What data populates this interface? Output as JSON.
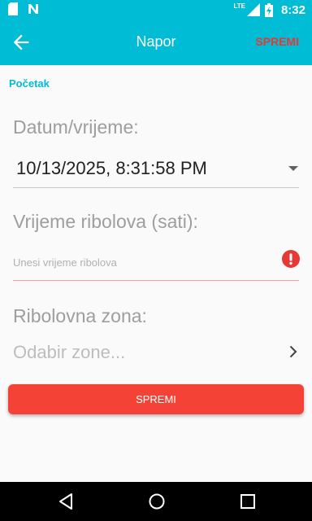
{
  "status_bar": {
    "time": "8:32",
    "network": "LTE",
    "icons": [
      "sd-card-icon",
      "n-notification-icon",
      "signal-icon",
      "battery-icon"
    ]
  },
  "toolbar": {
    "back_icon": "arrow-back-icon",
    "title": "Napor",
    "save_label": "SPREMI"
  },
  "breadcrumb": "Početak",
  "form": {
    "datetime_label": "Datum/vrijeme:",
    "datetime_value": "10/13/2025, 8:31:58 PM",
    "fishing_time_label": "Vrijeme ribolova (sati):",
    "fishing_time_placeholder": "Unesi vrijeme ribolova",
    "fishing_time_value": "",
    "zone_label": "Ribolovna zona:",
    "zone_placeholder": "Odabir zone..."
  },
  "save_button_label": "SPREMI",
  "nav_bar": {
    "buttons": [
      "back-triangle-icon",
      "home-circle-icon",
      "recents-square-icon"
    ]
  },
  "colors": {
    "primary": "#00bcd4",
    "accent_red": "#f44336",
    "error_red": "#e53935"
  }
}
